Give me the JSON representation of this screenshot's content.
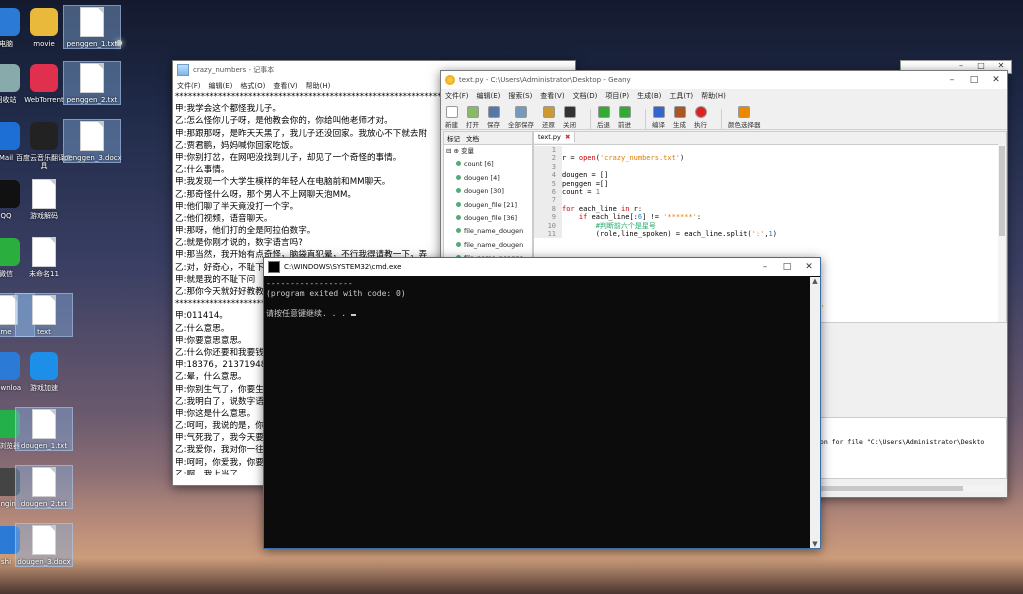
{
  "desktop": {
    "icons": [
      {
        "label": "电脑",
        "name": "computer"
      },
      {
        "label": "movie",
        "name": "movie-folder"
      },
      {
        "label": "penggen_1.txt",
        "name": "penggen-1-file"
      },
      {
        "label": "回收站",
        "name": "recycle-bin"
      },
      {
        "label": "WebTorrent",
        "name": "webtorrent"
      },
      {
        "label": "penggen_2.txt",
        "name": "penggen-2-file"
      },
      {
        "label": "Mail",
        "name": "mail"
      },
      {
        "label": "百度云音乐翻译工具",
        "name": "baidu-cloud-tool"
      },
      {
        "label": "penggen_3.docx",
        "name": "penggen-3-file"
      },
      {
        "label": "QQ",
        "name": "qq"
      },
      {
        "label": "游戏解码",
        "name": "game-decode-file"
      },
      {
        "label": "微信",
        "name": "wechat"
      },
      {
        "label": "未命名11",
        "name": "untitled-11-file"
      },
      {
        "label": "me",
        "name": "me-file"
      },
      {
        "label": "text",
        "name": "text-file"
      },
      {
        "label": "Downloa",
        "name": "downloads"
      },
      {
        "label": "游戏加速",
        "name": "game-accelerator"
      },
      {
        "label": "全浏览器",
        "name": "browser"
      },
      {
        "label": "dougen_1.txt",
        "name": "dougen-1-file"
      },
      {
        "label": "Engin",
        "name": "engine"
      },
      {
        "label": "dougen_2.txt",
        "name": "dougen-2-file"
      },
      {
        "label": "shi",
        "name": "shi"
      },
      {
        "label": "dougen_3.docx",
        "name": "dougen-3-file"
      }
    ]
  },
  "notepad": {
    "title": "crazy_numbers - 记事本",
    "menu": [
      "文件(F)",
      "编辑(E)",
      "格式(O)",
      "查看(V)",
      "帮助(H)"
    ],
    "lines": [
      "**************************************************************************",
      "甲:我学会这个都怪我儿子。",
      "乙:怎么怪你儿子呀，是他教会你的，你给叫他老师才对。",
      "甲:那跟那呀，是昨天天黑了，我儿子还没回家。我放心不下就去附",
      "乙:贾君鹏，妈妈喊你回家吃饭。",
      "甲:你别打岔，在网吧没找到儿子，却见了一个奇怪的事情。",
      "乙:什么事情。",
      "甲:我发现一个大学生模样的年轻人在电脑前和MM聊天。",
      "乙:那奇怪什么呀，那个男人不上网聊天泡MM。",
      "甲:他们聊了半天竟没打一个字。",
      "乙:他们视频，语音聊天。",
      "甲:那呀，他们打的全是阿拉伯数字。",
      "乙:就是你刚才说的，数字语言吗?",
      "甲:那当然，我开始有点奇怪，脑袋直犯晕，不行我得请教一下，弄",
      "乙:对，好奇心，不耻下问",
      "甲:就是我的不耻下问",
      "乙:那你今天就好好教教",
      "**************************************************************************",
      "甲:011414。",
      "乙:什么意思。",
      "甲:你要意思意思。",
      "乙:什么你还要和我要钱",
      "甲:18376，2137194873",
      "乙:晕，什么意思。",
      "甲:你别生气了，你要生",
      "乙:我明白了，说数字语",
      "甲:你这是什么意思。",
      "乙:呵呵，我说的是，你",
      "甲:气死我了，我今天要",
      "乙:我爱你，我对你一往",
      "甲:呵呵，你爱我，你要",
      "乙:啊，我上当了。"
    ]
  },
  "geany": {
    "title": "text.py - C:\\Users\\Administrator\\Desktop - Geany",
    "menu": [
      "文件(F)",
      "编辑(E)",
      "搜索(S)",
      "查看(V)",
      "文档(D)",
      "项目(P)",
      "生成(B)",
      "工具(T)",
      "帮助(H)"
    ],
    "toolbar": [
      {
        "label": "新建",
        "icon": "new-file-icon"
      },
      {
        "label": "打开",
        "icon": "open-folder-icon"
      },
      {
        "label": "保存",
        "icon": "save-icon"
      },
      {
        "label": "全部保存",
        "icon": "save-all-icon"
      },
      {
        "label": "还原",
        "icon": "revert-icon"
      },
      {
        "label": "关闭",
        "icon": "close-file-icon"
      },
      {
        "label": "后退",
        "icon": "back-arrow-icon"
      },
      {
        "label": "前进",
        "icon": "forward-arrow-icon"
      },
      {
        "label": "编译",
        "icon": "compile-icon"
      },
      {
        "label": "生成",
        "icon": "build-icon"
      },
      {
        "label": "执行",
        "icon": "execute-icon"
      },
      {
        "label": "颜色选择器",
        "icon": "color-picker-icon"
      }
    ],
    "side_tabs": [
      "标记",
      "文档"
    ],
    "symbols_root": "变量",
    "symbols": [
      "count [6]",
      "dougen [4]",
      "dougen [30]",
      "dougen_file [21]",
      "dougen_file [36]",
      "file_name_dougen",
      "file_name_dougen",
      "file_name_pengge"
    ],
    "editor_tab": "text.py",
    "code_line_numbers": [
      "1",
      "2",
      "3",
      "4",
      "5",
      "6",
      "7",
      "8",
      "9",
      "10",
      "11"
    ],
    "message": "ion for file \"C:\\Users\\Administrator\\Deskto"
  },
  "cmd": {
    "title": "C:\\WINDOWS\\SYSTEM32\\cmd.exe",
    "lines": [
      "------------------",
      "(program exited with code: 0)",
      "",
      "请按任意键继续. . . "
    ]
  }
}
